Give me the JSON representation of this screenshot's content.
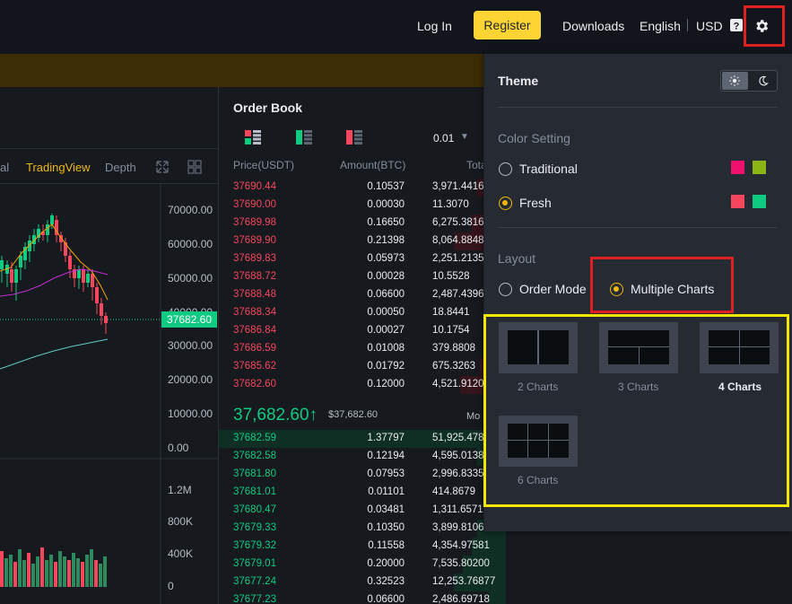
{
  "header": {
    "login": "Log In",
    "register": "Register",
    "downloads": "Downloads",
    "language": "English",
    "currency": "USD"
  },
  "chart": {
    "tab_fragment": "al",
    "tab_tradingview": "TradingView",
    "tab_depth": "Depth",
    "price_axis": [
      "70000.00",
      "60000.00",
      "50000.00",
      "40000.00",
      "30000.00",
      "20000.00",
      "10000.00",
      "0.00"
    ],
    "current_price_tag": "37682.60",
    "volume_axis": [
      "1.2M",
      "800K",
      "400K",
      "0"
    ]
  },
  "orderbook": {
    "title": "Order Book",
    "precision": "0.01",
    "col_price": "Price(USDT)",
    "col_amount": "Amount(BTC)",
    "col_total": "Total",
    "asks": [
      {
        "price": "37690.44",
        "amount": "0.10537",
        "total": "3,971.4416"
      },
      {
        "price": "37690.00",
        "amount": "0.00030",
        "total": "11.3070"
      },
      {
        "price": "37689.98",
        "amount": "0.16650",
        "total": "6,275.3816"
      },
      {
        "price": "37689.90",
        "amount": "0.21398",
        "total": "8,064.8848"
      },
      {
        "price": "37689.83",
        "amount": "0.05973",
        "total": "2,251.2135"
      },
      {
        "price": "37688.72",
        "amount": "0.00028",
        "total": "10.5528"
      },
      {
        "price": "37688.48",
        "amount": "0.06600",
        "total": "2,487.4396"
      },
      {
        "price": "37688.34",
        "amount": "0.00050",
        "total": "18.8441"
      },
      {
        "price": "37686.84",
        "amount": "0.00027",
        "total": "10.1754"
      },
      {
        "price": "37686.59",
        "amount": "0.01008",
        "total": "379.8808"
      },
      {
        "price": "37685.62",
        "amount": "0.01792",
        "total": "675.3263"
      },
      {
        "price": "37682.60",
        "amount": "0.12000",
        "total": "4,521.9120"
      }
    ],
    "mid_price": "37,682.60",
    "mid_arrow": "↑",
    "mid_usd": "$37,682.60",
    "mid_more": "Mo",
    "bids": [
      {
        "price": "37682.59",
        "amount": "1.37797",
        "total": "51,925.4785"
      },
      {
        "price": "37682.58",
        "amount": "0.12194",
        "total": "4,595.0138"
      },
      {
        "price": "37681.80",
        "amount": "0.07953",
        "total": "2,996.8335"
      },
      {
        "price": "37681.01",
        "amount": "0.01101",
        "total": "414.8679"
      },
      {
        "price": "37680.47",
        "amount": "0.03481",
        "total": "1,311.6571"
      },
      {
        "price": "37679.33",
        "amount": "0.10350",
        "total": "3,899.8106"
      },
      {
        "price": "37679.32",
        "amount": "0.11558",
        "total": "4,354.97581"
      },
      {
        "price": "37679.01",
        "amount": "0.20000",
        "total": "7,535.80200"
      },
      {
        "price": "37677.24",
        "amount": "0.32523",
        "total": "12,253.76877"
      },
      {
        "price": "37677.23",
        "amount": "0.06600",
        "total": "2,486.69718"
      }
    ]
  },
  "settings": {
    "theme_title": "Theme",
    "color_setting_title": "Color Setting",
    "color_options": [
      {
        "label": "Traditional",
        "checked": false,
        "up_color": "#f0116f",
        "down_color": "#8bb515"
      },
      {
        "label": "Fresh",
        "checked": true,
        "up_color": "#f6465d",
        "down_color": "#0ecb81"
      }
    ],
    "layout_title": "Layout",
    "layout_modes": [
      {
        "label": "Order Mode",
        "checked": false
      },
      {
        "label": "Multiple Charts",
        "checked": true
      }
    ],
    "chart_layouts": [
      {
        "label": "2 Charts",
        "active": false
      },
      {
        "label": "3 Charts",
        "active": false
      },
      {
        "label": "4 Charts",
        "active": true
      },
      {
        "label": "6 Charts",
        "active": false
      }
    ]
  },
  "colors": {
    "accent": "#fcd535",
    "up": "#0ecb81",
    "down": "#f6465d",
    "highlight_red": "#e02020",
    "highlight_yellow": "#f5e600"
  }
}
